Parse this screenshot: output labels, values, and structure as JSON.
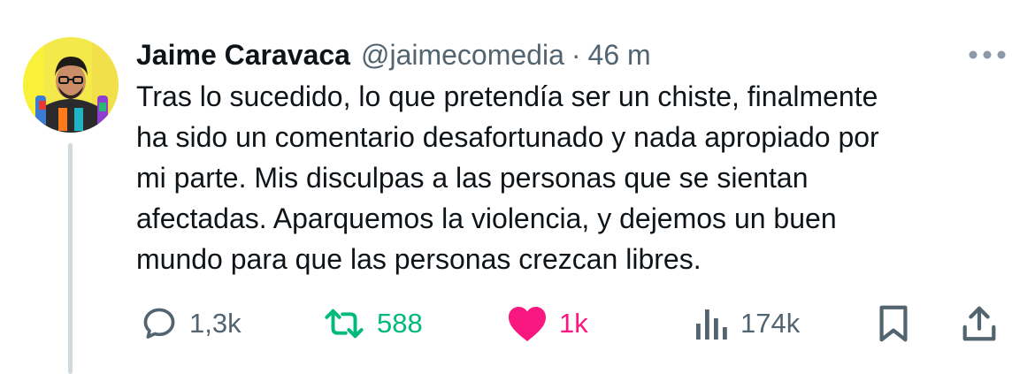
{
  "author": {
    "name": "Jaime Caravaca",
    "handle": "@jaimecomedia",
    "separator": "·",
    "time": "46 m"
  },
  "tweet": {
    "text": "Tras lo sucedido, lo que pretendía ser un chiste, finalmente\nha sido un comentario desafortunado y nada apropiado por\nmi parte. Mis disculpas a las personas que se sientan\nafectadas. Aparquemos la violencia, y dejemos un buen\nmundo para que las personas crezcan libres."
  },
  "actions": {
    "replies": "1,3k",
    "retweets": "588",
    "likes": "1k",
    "views": "174k",
    "reply_icon": "speech-bubble-icon",
    "retweet_icon": "retweet-arrows-icon",
    "like_icon": "heart-filled-icon",
    "views_icon": "bar-chart-icon",
    "bookmark_icon": "bookmark-icon",
    "share_icon": "share-upload-icon"
  },
  "colors": {
    "text": "#0f1419",
    "muted": "#536471",
    "retweet_green": "#00ba7c",
    "like_pink": "#f91880",
    "thread_line": "#cfd9de"
  }
}
